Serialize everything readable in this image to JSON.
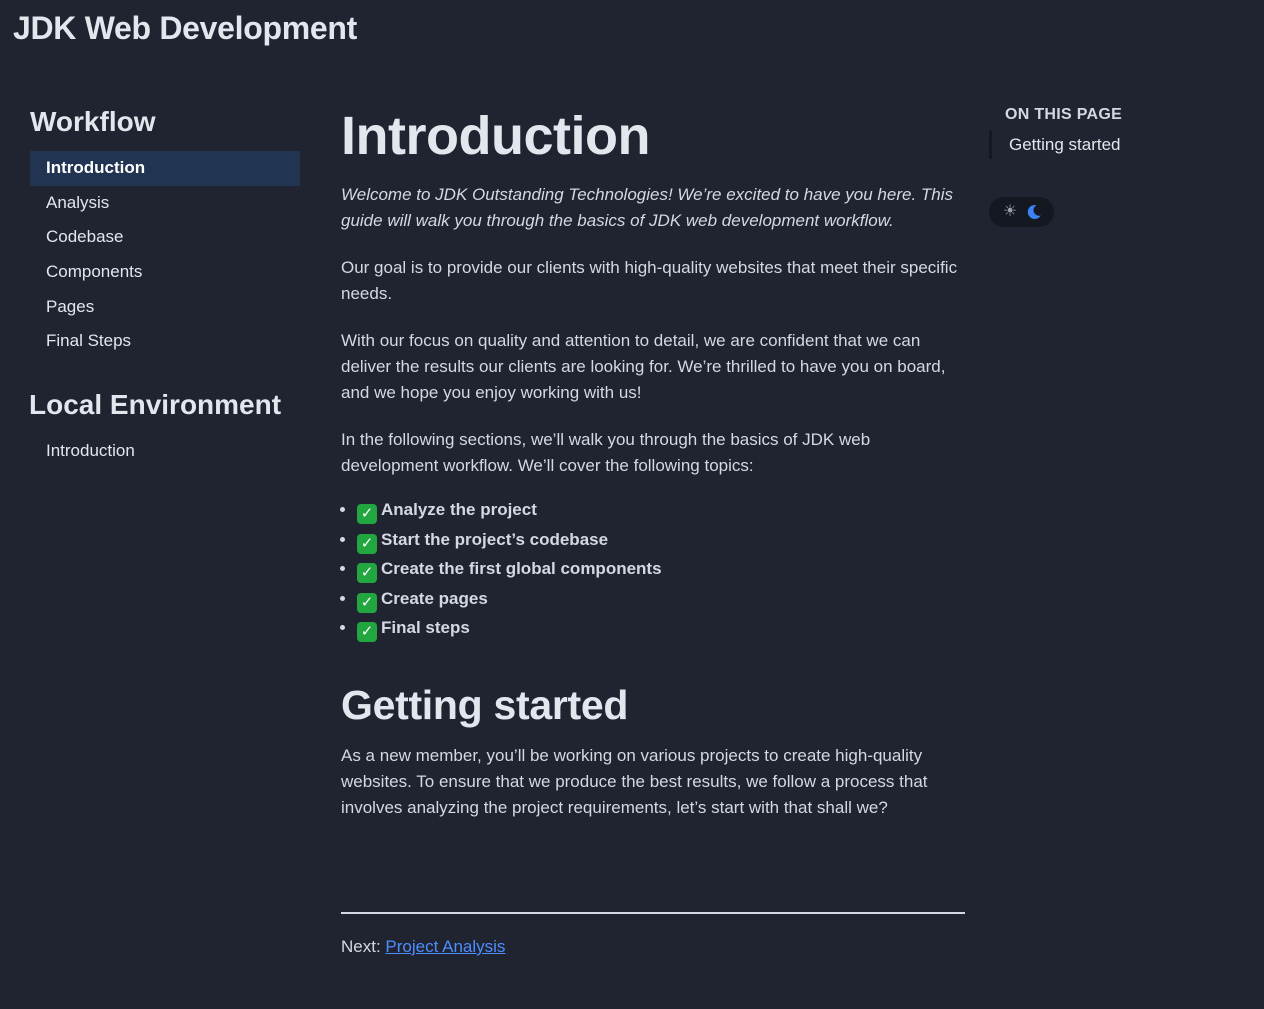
{
  "site": {
    "title": "JDK Web Development"
  },
  "sidebar": {
    "sections": [
      {
        "heading": "Workflow",
        "items": [
          {
            "label": "Introduction",
            "active": true
          },
          {
            "label": "Analysis",
            "active": false
          },
          {
            "label": "Codebase",
            "active": false
          },
          {
            "label": "Components",
            "active": false
          },
          {
            "label": "Pages",
            "active": false
          },
          {
            "label": "Final Steps",
            "active": false
          }
        ]
      },
      {
        "heading": "Local Environment",
        "items": [
          {
            "label": "Introduction",
            "active": false
          }
        ]
      }
    ]
  },
  "main": {
    "title": "Introduction",
    "lead": "Welcome to JDK Outstanding Technologies! We’re excited to have you here. This guide will walk you through the basics of JDK web development workflow.",
    "paragraphs": [
      "Our goal is to provide our clients with high-quality websites that meet their specific needs.",
      "With our focus on quality and attention to detail, we are confident that we can deliver the results our clients are looking for. We’re thrilled to have you on board, and we hope you enjoy working with us!",
      "In the following sections, we’ll walk you through the basics of JDK web development workflow. We’ll cover the following topics:"
    ],
    "topics": [
      "Analyze the project",
      "Start the project’s codebase",
      "Create the first global components",
      "Create pages",
      "Final steps"
    ],
    "topic_icon": "check-mark-button-icon",
    "section": {
      "heading": "Getting started",
      "paragraph": "As a new member, you’ll be working on various projects to create high-quality websites. To ensure that we produce the best results, we follow a process that involves analyzing the project requirements, let’s start with that shall we?"
    }
  },
  "footer_nav": {
    "prefix": "Next:",
    "link_label": "Project Analysis"
  },
  "toc": {
    "heading": "ON THIS PAGE",
    "items": [
      "Getting started"
    ]
  },
  "theme_toggle": {
    "icons": [
      "sun-icon",
      "moon-icon"
    ],
    "active": "dark"
  },
  "colors": {
    "background": "#1f2430",
    "active_item": "#213452",
    "link": "#4c8dff",
    "check": "#22a640",
    "moon": "#3b82f6"
  }
}
